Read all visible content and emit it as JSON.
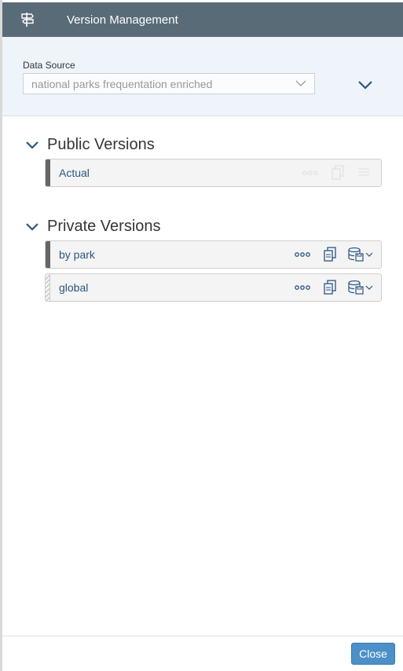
{
  "header": {
    "title": "Version Management",
    "icon": "signpost-icon"
  },
  "data_source": {
    "label": "Data Source",
    "value": "national parks frequentation enriched"
  },
  "public_versions": {
    "title": "Public Versions",
    "items": [
      {
        "name": "Actual",
        "state": "disabled-actions"
      }
    ]
  },
  "private_versions": {
    "title": "Private Versions",
    "items": [
      {
        "name": "by park"
      },
      {
        "name": "global"
      }
    ]
  },
  "footer": {
    "close_label": "Close"
  },
  "colors": {
    "header_bg": "#5a6b78",
    "link": "#2a5582",
    "accent": "#4d8fc9"
  }
}
